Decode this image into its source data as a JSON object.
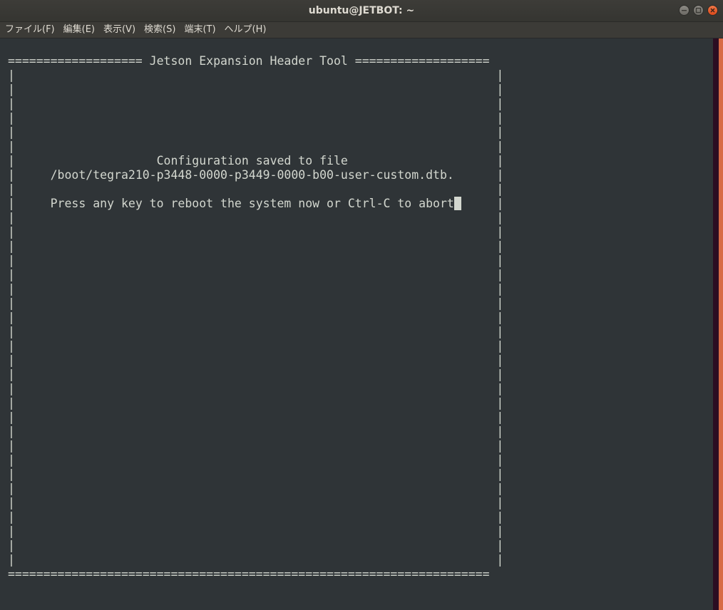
{
  "window": {
    "title": "ubuntu@JETBOT: ~",
    "controls": [
      {
        "name": "minimize",
        "icon": "minimize-icon"
      },
      {
        "name": "maximize",
        "icon": "maximize-icon"
      },
      {
        "name": "close",
        "icon": "close-icon"
      }
    ]
  },
  "menu": {
    "items": [
      "ファイル(F)",
      "編集(E)",
      "表示(V)",
      "検索(S)",
      "端末(T)",
      "ヘルプ(H)"
    ]
  },
  "terminal": {
    "header_line": "=================== Jetson Expansion Header Tool ===================",
    "border_char": "|",
    "message_line1": "Configuration saved to file",
    "message_line2": "/boot/tegra210-p3448-0000-p3449-0000-b00-user-custom.dtb.",
    "prompt": "Press any key to reboot the system now or Ctrl-C to abort",
    "footer_line": "===================================================================="
  },
  "colors": {
    "terminal_bg": "#2f3437",
    "terminal_fg": "#d3d7cf",
    "titlebar_bg": "#3d3c38",
    "close_button": "#e9541f",
    "scrollbar_bg": "#2b0d22",
    "accent_edge": "#d86b45"
  }
}
